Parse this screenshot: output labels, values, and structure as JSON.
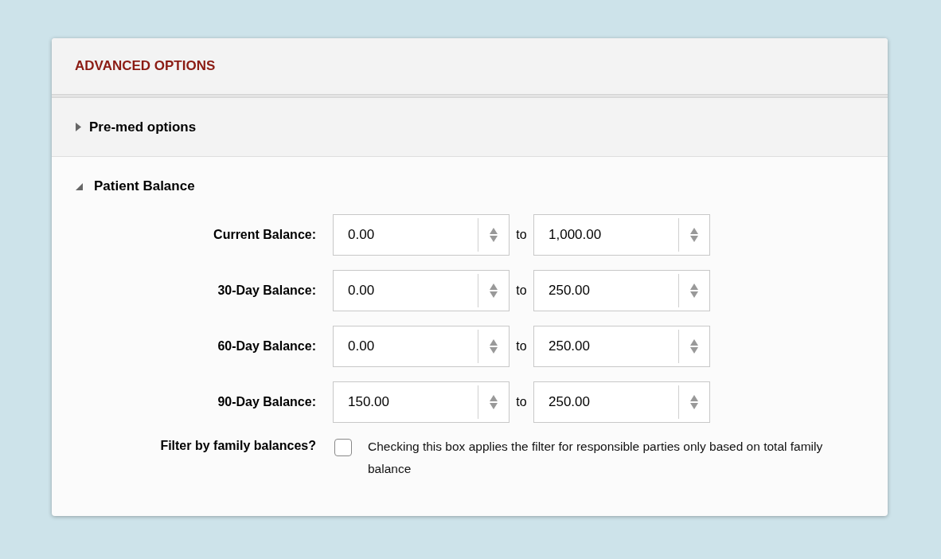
{
  "panel": {
    "title": "ADVANCED OPTIONS"
  },
  "sections": [
    {
      "title": "Pre-med options",
      "expanded": false
    },
    {
      "title": "Patient Balance",
      "expanded": true
    }
  ],
  "balance_rows": [
    {
      "label": "Current Balance:",
      "from": "0.00",
      "separator": "to",
      "to": "1,000.00"
    },
    {
      "label": "30-Day Balance:",
      "from": "0.00",
      "separator": "to",
      "to": "250.00"
    },
    {
      "label": "60-Day Balance:",
      "from": "0.00",
      "separator": "to",
      "to": "250.00"
    },
    {
      "label": "90-Day Balance:",
      "from": "150.00",
      "separator": "to",
      "to": "250.00"
    }
  ],
  "family_filter": {
    "label": "Filter by family balances?",
    "checked": false,
    "description": "Checking this box applies the filter for responsible parties only based on total family balance"
  }
}
